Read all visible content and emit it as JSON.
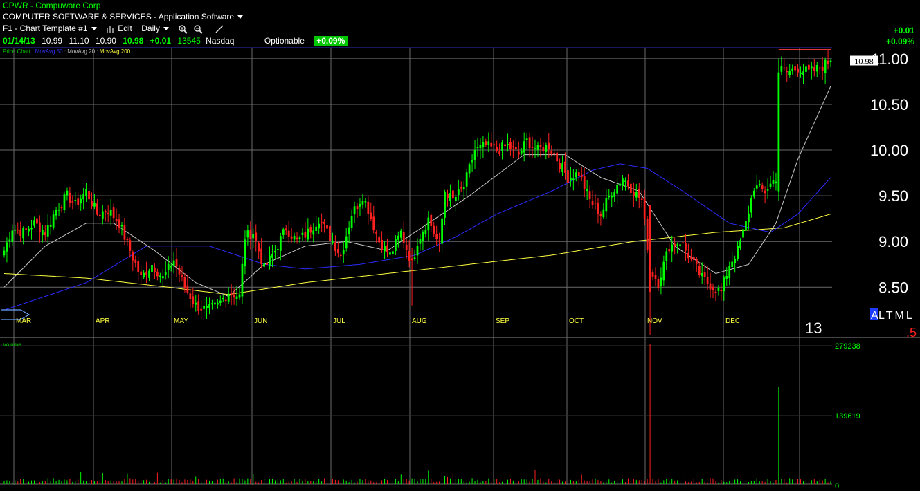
{
  "header": {
    "symbol": "CPWR",
    "separator": " - ",
    "company": "Compuware Corp",
    "industry": "COMPUTER SOFTWARE & SERVICES - Application Software",
    "template": "F1 - Chart Template #1",
    "edit_label": "Edit",
    "period": "Daily",
    "date": "01/14/13",
    "open": "10.99",
    "high": "11.10",
    "low": "10.90",
    "close": "10.98",
    "change": "+0.01",
    "volume": "13545",
    "exchange": "Nasdaq",
    "optionable": "Optionable",
    "change_pct_box": "+0.09%",
    "right_change": "+0.01",
    "right_pct": "+0.09%"
  },
  "indicators": {
    "price_chart": "Price Chart",
    "sep": " : ",
    "ma50": "MovAvg 50",
    "ma20": "MovAvg 20",
    "ma200": "MovAvg 200",
    "volume_label": "Volume"
  },
  "colors": {
    "up": "#00ff00",
    "down": "#ff2020",
    "ma50": "#2b2bff",
    "ma20": "#c8c8c8",
    "ma200": "#ffff40",
    "grid": "#6a6a6a",
    "top_line": "#3030c0",
    "resistance": "#ff4040"
  },
  "chart_data": {
    "type": "candlestick",
    "price_axis": {
      "ticks": [
        "8.50",
        "9.00",
        "9.50",
        "10.00",
        "10.50",
        "11.00"
      ],
      "values": [
        8.5,
        9.0,
        9.5,
        10.0,
        10.5,
        11.0
      ],
      "min": 7.95,
      "max": 11.12
    },
    "months": [
      "MAR",
      "APR",
      "MAY",
      "JUN",
      "JUL",
      "AUG",
      "SEP",
      "OCT",
      "NOV",
      "DEC"
    ],
    "year_label": "13",
    "last_price_label": "10.98",
    "volume_axis": {
      "ticks": [
        "279238",
        "139619",
        "0"
      ],
      "values": [
        279238,
        139619,
        0
      ]
    },
    "resistance_level": 11.1,
    "overlay_text": {
      "a": "A",
      "rest": "LTML",
      "five": ".5"
    },
    "price_anchors": [
      [
        0,
        8.9
      ],
      [
        3,
        9.15
      ],
      [
        7,
        9.1
      ],
      [
        11,
        9.2
      ],
      [
        15,
        9.1
      ],
      [
        19,
        9.35
      ],
      [
        23,
        9.5
      ],
      [
        26,
        9.4
      ],
      [
        30,
        9.55
      ],
      [
        34,
        9.3
      ],
      [
        38,
        9.35
      ],
      [
        42,
        9.2
      ],
      [
        46,
        8.9
      ],
      [
        50,
        8.6
      ],
      [
        54,
        8.75
      ],
      [
        58,
        8.6
      ],
      [
        62,
        8.8
      ],
      [
        66,
        8.5
      ],
      [
        70,
        8.3
      ],
      [
        74,
        8.25
      ],
      [
        78,
        8.3
      ],
      [
        82,
        8.45
      ],
      [
        86,
        8.4
      ],
      [
        88,
        9.05
      ],
      [
        91,
        9.1
      ],
      [
        95,
        8.7
      ],
      [
        99,
        8.9
      ],
      [
        103,
        9.15
      ],
      [
        107,
        9.0
      ],
      [
        111,
        9.1
      ],
      [
        115,
        9.25
      ],
      [
        119,
        9.05
      ],
      [
        123,
        8.85
      ],
      [
        127,
        9.3
      ],
      [
        131,
        9.5
      ],
      [
        133,
        9.35
      ],
      [
        137,
        9.0
      ],
      [
        141,
        8.85
      ],
      [
        145,
        9.1
      ],
      [
        149,
        8.75
      ],
      [
        151,
        9.0
      ],
      [
        155,
        9.25
      ],
      [
        159,
        8.95
      ],
      [
        161,
        9.55
      ],
      [
        164,
        9.45
      ],
      [
        168,
        9.6
      ],
      [
        172,
        10.0
      ],
      [
        176,
        10.05
      ],
      [
        180,
        10.0
      ],
      [
        184,
        10.05
      ],
      [
        188,
        9.95
      ],
      [
        191,
        10.1
      ],
      [
        195,
        10.0
      ],
      [
        199,
        10.05
      ],
      [
        202,
        9.9
      ],
      [
        206,
        9.7
      ],
      [
        210,
        9.75
      ],
      [
        214,
        9.45
      ],
      [
        218,
        9.3
      ],
      [
        222,
        9.55
      ],
      [
        226,
        9.7
      ],
      [
        230,
        9.55
      ],
      [
        233,
        9.45
      ],
      [
        236,
        8.7
      ],
      [
        239,
        8.55
      ],
      [
        243,
        8.95
      ],
      [
        247,
        9.0
      ],
      [
        251,
        8.8
      ],
      [
        255,
        8.6
      ],
      [
        259,
        8.5
      ],
      [
        262,
        8.45
      ],
      [
        265,
        8.75
      ],
      [
        268,
        8.9
      ],
      [
        271,
        9.2
      ],
      [
        274,
        9.6
      ],
      [
        278,
        9.55
      ],
      [
        282,
        9.7
      ],
      [
        283,
        10.9
      ],
      [
        286,
        10.85
      ],
      [
        290,
        10.9
      ],
      [
        294,
        10.85
      ],
      [
        298,
        10.9
      ],
      [
        302,
        10.98
      ]
    ],
    "ma50_anchors": [
      [
        0,
        8.25
      ],
      [
        30,
        8.55
      ],
      [
        52,
        8.95
      ],
      [
        75,
        8.95
      ],
      [
        95,
        8.75
      ],
      [
        110,
        8.7
      ],
      [
        130,
        8.75
      ],
      [
        150,
        8.85
      ],
      [
        165,
        9.05
      ],
      [
        180,
        9.3
      ],
      [
        200,
        9.55
      ],
      [
        215,
        9.78
      ],
      [
        225,
        9.85
      ],
      [
        235,
        9.8
      ],
      [
        248,
        9.55
      ],
      [
        265,
        9.2
      ],
      [
        280,
        9.1
      ],
      [
        290,
        9.3
      ],
      [
        302,
        9.7
      ]
    ],
    "ma20_anchors": [
      [
        0,
        8.5
      ],
      [
        15,
        8.95
      ],
      [
        30,
        9.2
      ],
      [
        40,
        9.2
      ],
      [
        55,
        8.9
      ],
      [
        70,
        8.55
      ],
      [
        82,
        8.4
      ],
      [
        95,
        8.75
      ],
      [
        110,
        8.95
      ],
      [
        125,
        9.0
      ],
      [
        140,
        8.9
      ],
      [
        155,
        9.2
      ],
      [
        170,
        9.5
      ],
      [
        190,
        9.95
      ],
      [
        205,
        9.95
      ],
      [
        218,
        9.7
      ],
      [
        232,
        9.55
      ],
      [
        245,
        8.95
      ],
      [
        260,
        8.65
      ],
      [
        272,
        8.75
      ],
      [
        282,
        9.2
      ],
      [
        290,
        9.9
      ],
      [
        302,
        10.7
      ]
    ],
    "ma200_anchors": [
      [
        0,
        8.65
      ],
      [
        30,
        8.6
      ],
      [
        60,
        8.5
      ],
      [
        82,
        8.42
      ],
      [
        110,
        8.55
      ],
      [
        140,
        8.65
      ],
      [
        170,
        8.75
      ],
      [
        200,
        8.85
      ],
      [
        230,
        9.0
      ],
      [
        260,
        9.1
      ],
      [
        285,
        9.15
      ],
      [
        302,
        9.3
      ]
    ],
    "volume_spikes": [
      {
        "bar": 236,
        "value": 279238,
        "dir": "down"
      },
      {
        "bar": 283,
        "value": 195000,
        "dir": "up"
      }
    ]
  }
}
